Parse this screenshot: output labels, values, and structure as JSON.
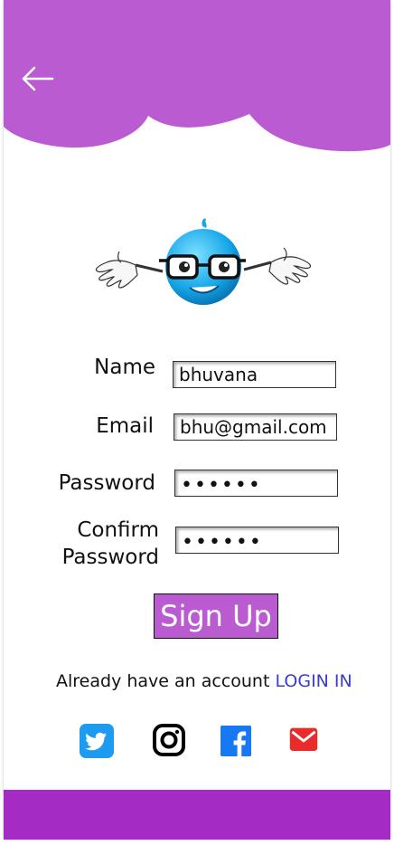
{
  "form": {
    "name_label": "Name",
    "name_value": "bhuvana",
    "email_label": "Email",
    "email_value": "bhu@gmail.com",
    "password_label": "Password",
    "password_value": "••••••",
    "confirm_label_line1": "Confirm",
    "confirm_label_line2": "Password",
    "confirm_value": "••••••"
  },
  "signup_label": "Sign Up",
  "login_prompt": {
    "text": "Already have an account",
    "link": "LOGIN IN"
  },
  "colors": {
    "header": "#bb5bd1",
    "footer": "#a42bc4",
    "link": "#3b3bd6",
    "twitter": "#1d9bf0",
    "facebook": "#1877f2",
    "mail": "#ea2b2b"
  },
  "icons": [
    "back-arrow-icon",
    "twitter-icon",
    "instagram-icon",
    "facebook-icon",
    "mail-icon"
  ]
}
